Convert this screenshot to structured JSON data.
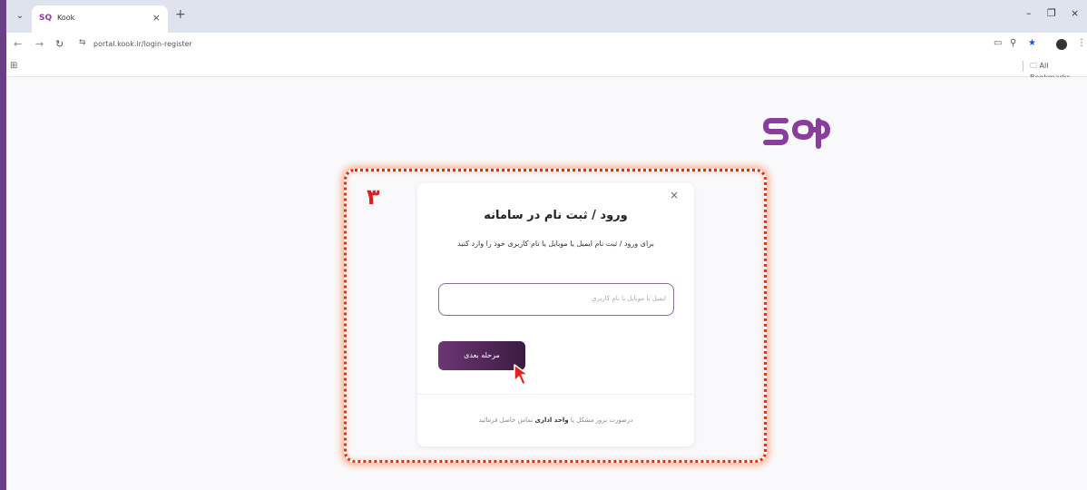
{
  "browser": {
    "tab_title": "Kook",
    "url": "portal.kook.ir/login-register",
    "bookmarks_label": "All Bookmarks",
    "new_tab": "+",
    "tab_close": "×"
  },
  "page": {
    "logo_color": "#8a3d9c",
    "step_number": "۳",
    "modal": {
      "close": "×",
      "title": "ورود / ثبت نام در سامانه",
      "subtitle": "برای ورود / ثبت نام ایمیل یا موبایل یا نام کاربری خود را وارد کنید",
      "input_placeholder": "ایمیل یا موبایل یا نام کاربری",
      "input_value": "",
      "next_button": "مرحله بعدی",
      "footer_before": "درصورت بروز مشکل با ",
      "footer_link": "واحد اداری",
      "footer_after": " تماس حاصل فرمائید"
    }
  }
}
